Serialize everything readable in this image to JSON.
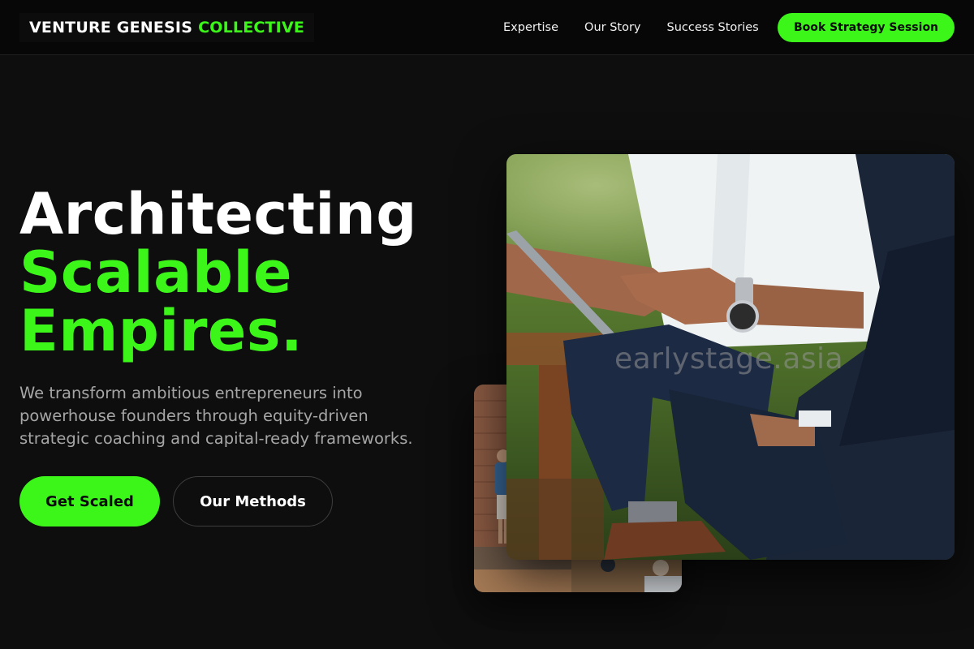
{
  "nav": {
    "logo_main": "VENTURE GENESIS",
    "logo_accent": "COLLECTIVE",
    "links": [
      {
        "label": "Expertise"
      },
      {
        "label": "Our Story"
      },
      {
        "label": "Success Stories"
      }
    ],
    "cta_label": "Book Strategy Session"
  },
  "hero": {
    "title_line1": "Architecting",
    "title_line2": "Scalable",
    "title_line3": "Empires.",
    "description": "We transform ambitious entrepreneurs into powerhouse founders through equity-driven strategic coaching and capital-ready frameworks.",
    "primary_button": "Get Scaled",
    "secondary_button": "Our Methods"
  },
  "images": {
    "watermark": "earlystage.asia"
  },
  "colors": {
    "accent": "#3cf61a",
    "background": "#0e0e0e",
    "navbar": "#070707",
    "muted_text": "#a6a6a6"
  }
}
